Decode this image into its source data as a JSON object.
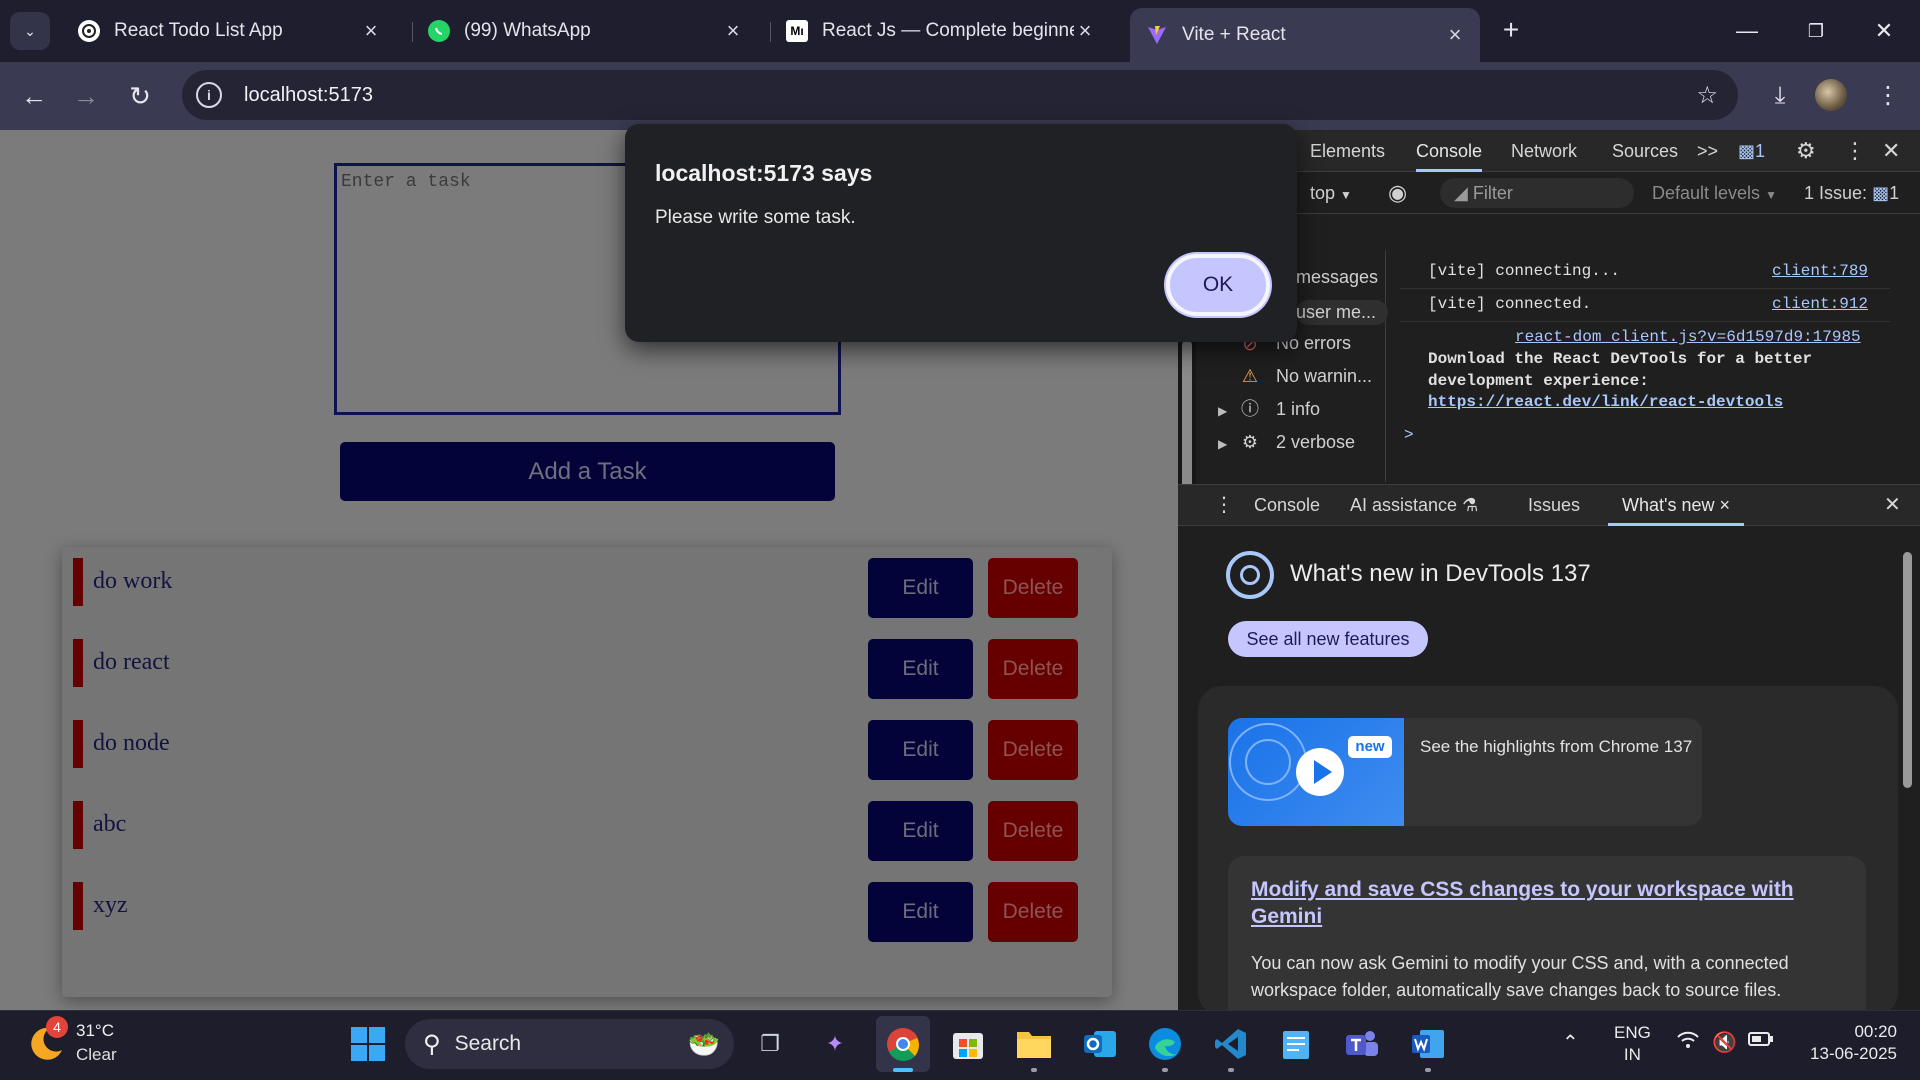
{
  "browser": {
    "tabs": [
      {
        "title": "React Todo List App",
        "active": false
      },
      {
        "title": "(99) WhatsApp",
        "active": false
      },
      {
        "title": "React Js — Complete beginners",
        "active": false
      },
      {
        "title": "Vite + React",
        "active": true
      }
    ],
    "medium_icon_text": "Mı",
    "url": "localhost:5173"
  },
  "app": {
    "input_placeholder": "Enter a task",
    "add_button": "Add a Task",
    "tasks": [
      {
        "text": "do work",
        "edit": "Edit",
        "delete": "Delete"
      },
      {
        "text": "do react",
        "edit": "Edit",
        "delete": "Delete"
      },
      {
        "text": "do node",
        "edit": "Edit",
        "delete": "Delete"
      },
      {
        "text": "abc",
        "edit": "Edit",
        "delete": "Delete"
      },
      {
        "text": "xyz",
        "edit": "Edit",
        "delete": "Delete"
      }
    ]
  },
  "dialog": {
    "title": "localhost:5173 says",
    "message": "Please write some task.",
    "ok": "OK"
  },
  "devtools": {
    "tabs": [
      "Elements",
      "Console",
      "Network",
      "Sources"
    ],
    "active_tab": "Console",
    "more": ">>",
    "issue_badge": "1",
    "context": "top",
    "filter_placeholder": "Filter",
    "levels": "Default levels",
    "issues_label": "1 Issue:",
    "issues_count": "1",
    "sidebar": [
      {
        "label": "messages",
        "icon": "list-icon"
      },
      {
        "label": "user me...",
        "icon": "user-icon"
      },
      {
        "label": "No errors",
        "icon": "error-icon"
      },
      {
        "label": "No warnin...",
        "icon": "warning-icon"
      },
      {
        "label": "1 info",
        "icon": "info-icon"
      },
      {
        "label": "2 verbose",
        "icon": "bug-icon"
      }
    ],
    "console": {
      "line1": "[vite] connecting...",
      "line1_src": "client:789",
      "line2": "[vite] connected.",
      "line2_src": "client:912",
      "line3_src": "react-dom_client.js?v=6d1597d9:17985",
      "line3_a": "Download the React DevTools for a better",
      "line3_b": "development experience:",
      "line3_link": "https://react.dev/link/react-devtools",
      "prompt": ">"
    },
    "drawer_tabs": [
      "Console",
      "AI assistance",
      "Issues",
      "What's new"
    ],
    "drawer_active": "What's new",
    "whatsnew": {
      "title": "What's new in DevTools 137",
      "see_all": "See all new features",
      "new_badge": "new",
      "video_caption": "See the highlights from Chrome 137",
      "feature_title": "Modify and save CSS changes to your workspace with Gemini",
      "feature_desc": "You can now ask Gemini to modify your CSS and, with a connected workspace folder, automatically save changes back to source files."
    }
  },
  "taskbar": {
    "weather_badge": "4",
    "temperature": "31°C",
    "condition": "Clear",
    "search": "Search",
    "lang1": "ENG",
    "lang2": "IN",
    "time": "00:20",
    "date": "13-06-2025"
  },
  "colors": {
    "alert_button": "#c6c6ff",
    "edit_button": "#03033a",
    "delete_button": "#660000",
    "devtools_accent": "#a8c7fa"
  }
}
